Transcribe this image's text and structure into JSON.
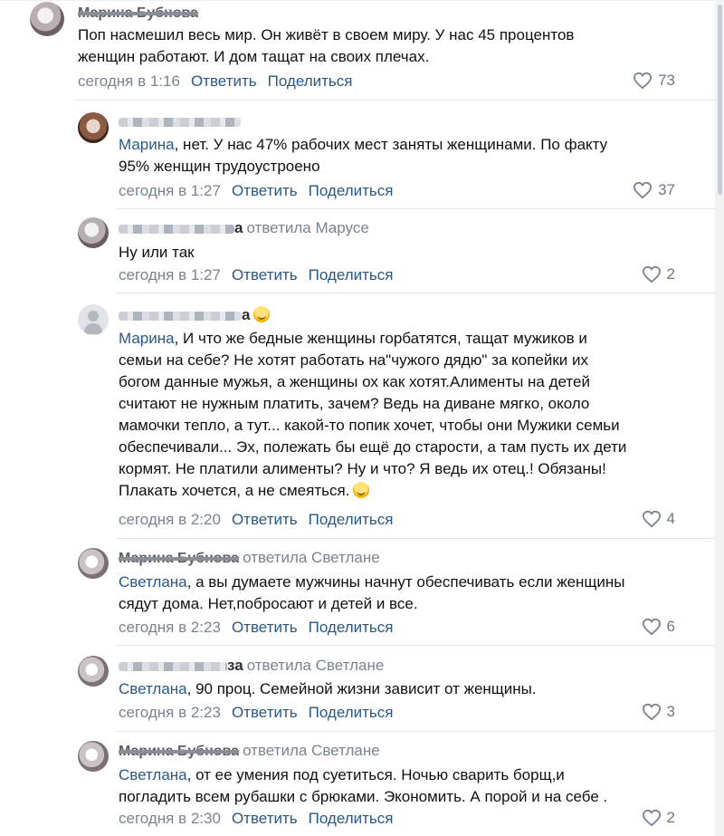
{
  "colors": {
    "link": "#2a5885",
    "meta": "#7a8392",
    "divider": "#e4e6ea",
    "likes": "#6f7785"
  },
  "comments": [
    {
      "author_tail": "Марина Бубнова",
      "replied_to": "",
      "mention": "",
      "text_lines": [
        "Поп насмешил весь мир. Он живёт в своем миру. У нас 45 процентов",
        "женщин работают. И дом тащат на своих плечах."
      ],
      "time": "сегодня в 1:16",
      "reply": "Ответить",
      "share": "Поделиться",
      "likes": "73"
    },
    {
      "author_tail": "",
      "replied_to": "",
      "mention": "Марина",
      "text_lines": [
        ", нет. У нас 47% рабочих мест заняты женщинами. По факту",
        "95% женщин трудоустроено"
      ],
      "time": "сегодня в 1:27",
      "reply": "Ответить",
      "share": "Поделиться",
      "likes": "37"
    },
    {
      "author_tail": "а",
      "replied_to": "ответила Марусе",
      "mention": "",
      "text_lines": [
        "Ну или так"
      ],
      "time": "сегодня в 1:27",
      "reply": "Ответить",
      "share": "Поделиться",
      "likes": "2"
    },
    {
      "author_tail": "а",
      "replied_to": "",
      "mention": "Марина",
      "text_lines": [
        ", И что же бедные женщины горбатятся, тащат мужиков и",
        "семьи на себе? Не хотят работать на\"чужого дядю\" за копейки их",
        "богом данные мужья, а женщины ох как хотят.Алименты на детей",
        "считают не нужным платить, зачем? Ведь на диване мягко, около",
        "мамочки тепло, а тут... какой-то попик хочет, чтобы они Мужики семьи",
        "обеспечивали... Эх, полежать бы ещё до старости, а там пусть их дети",
        "кормят. Не платили алименты? Ну и что? Я ведь их отец.! Обязаны!",
        "Плакать хочется, а не смеяться."
      ],
      "time": "сегодня в 2:20",
      "reply": "Ответить",
      "share": "Поделиться",
      "likes": "4"
    },
    {
      "author_tail": "Марина Бубнова",
      "replied_to": "ответила Светлане",
      "mention": "Светлана",
      "text_lines": [
        ", а вы думаете мужчины начнут обеспечивать если женщины",
        "сядут дома. Нет,побросают и детей и все."
      ],
      "time": "сегодня в 2:23",
      "reply": "Ответить",
      "share": "Поделиться",
      "likes": "6"
    },
    {
      "author_tail": "за",
      "replied_to": "ответила Светлане",
      "mention": "Светлана",
      "text_lines": [
        ", 90 проц. Семейной жизни зависит от женщины."
      ],
      "time": "сегодня в 2:23",
      "reply": "Ответить",
      "share": "Поделиться",
      "likes": "3"
    },
    {
      "author_tail": "Марина Бубнова",
      "replied_to": "ответила Светлане",
      "mention": "Светлана",
      "text_lines": [
        ", от ее умения под суетиться. Ночью сварить борщ,и",
        "погладить всем рубашки с брюками. Экономить. А порой и на себе ."
      ],
      "time": "сегодня в 2:30",
      "reply": "Ответить",
      "share": "Поделиться",
      "likes": "2"
    }
  ]
}
